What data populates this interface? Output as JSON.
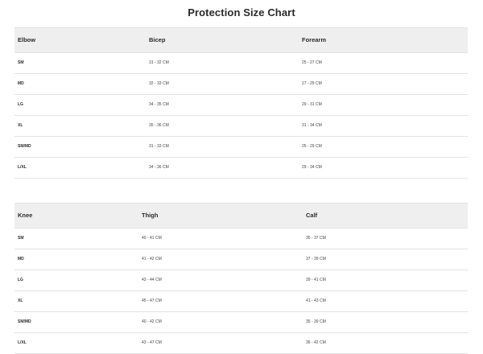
{
  "title": "Protection Size Chart",
  "elbow_table": {
    "headers": [
      "Elbow",
      "Bicep",
      "Forearm"
    ],
    "rows": [
      [
        "SM",
        "31 - 32 CM",
        "25 - 27 CM"
      ],
      [
        "MD",
        "32 - 33 CM",
        "27 - 29 CM"
      ],
      [
        "LG",
        "34 - 35 CM",
        "29 - 31 CM"
      ],
      [
        "XL",
        "35 - 36 CM",
        "31 - 34 CM"
      ],
      [
        "SM/MD",
        "31 - 33 CM",
        "25 - 29 CM"
      ],
      [
        "L/XL",
        "34 - 36 CM",
        "29 - 34 CM"
      ]
    ]
  },
  "knee_table": {
    "headers": [
      "Knee",
      "Thigh",
      "Calf"
    ],
    "rows": [
      [
        "SM",
        "40 - 41 CM",
        "35 - 37 CM"
      ],
      [
        "MD",
        "41 - 42 CM",
        "37 - 39 CM"
      ],
      [
        "LG",
        "43 - 44 CM",
        "39 - 41 CM"
      ],
      [
        "XL",
        "45 - 47 CM",
        "41 - 43 CM"
      ],
      [
        "SM/MD",
        "40 - 42 CM",
        "35 - 39 CM"
      ],
      [
        "L/XL",
        "43 - 47 CM",
        "36 - 42 CM"
      ]
    ]
  }
}
